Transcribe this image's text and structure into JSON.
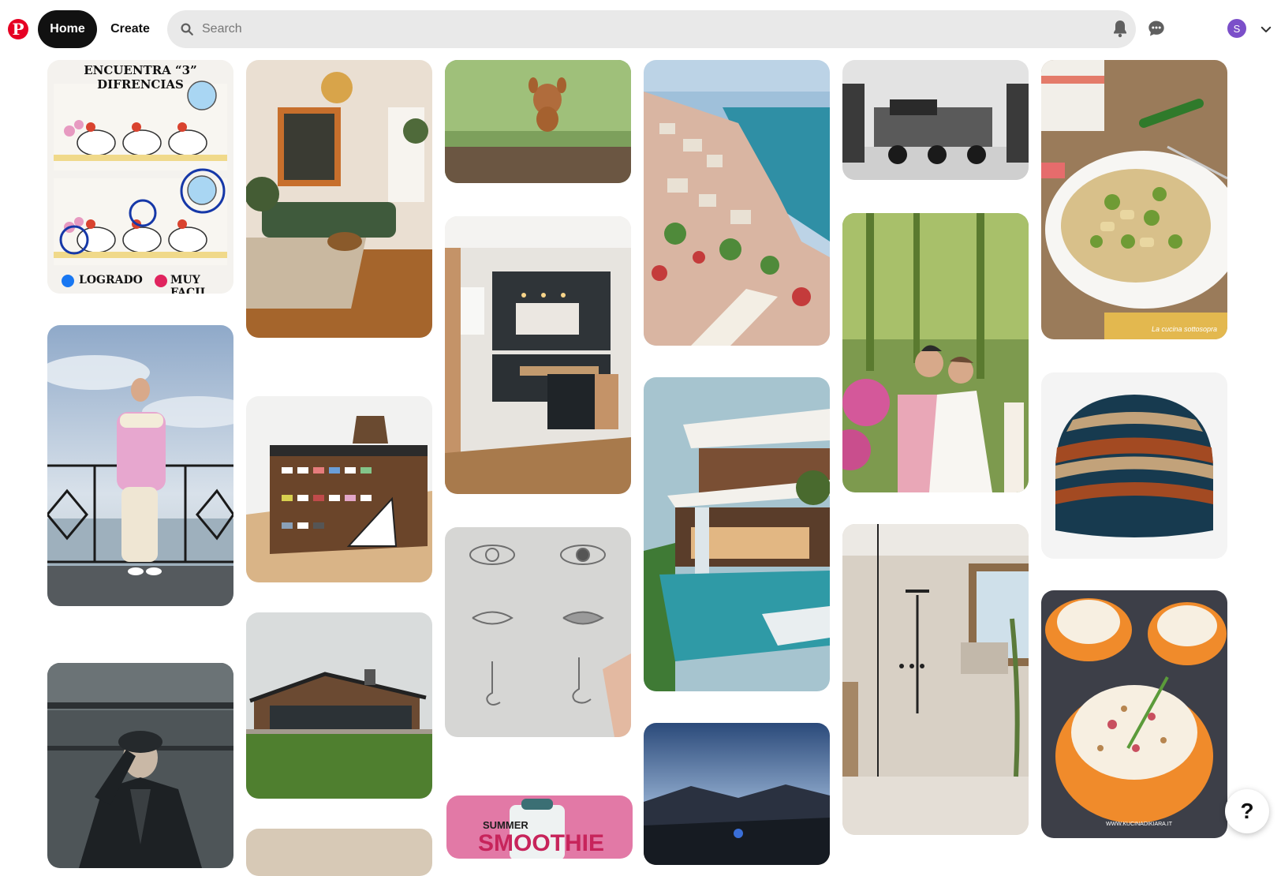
{
  "header": {
    "logo_letter": "P",
    "home_label": "Home",
    "create_label": "Create",
    "search_placeholder": "Search",
    "avatar_initial": "S"
  },
  "pins": {
    "puzzle": {
      "title": "ENCUENTRA “3” DIFRENCIAS",
      "left_tag": "LOGRADO",
      "right_tag": "MUY FACIL"
    },
    "pasta_watermark": "La cucina sottosopra",
    "apricot_watermark": "WWW.KUCINADIKIARA.IT",
    "smoothie_text_top": "SUMMER",
    "smoothie_text_bottom": "SMOOTHIE"
  },
  "help_label": "?"
}
